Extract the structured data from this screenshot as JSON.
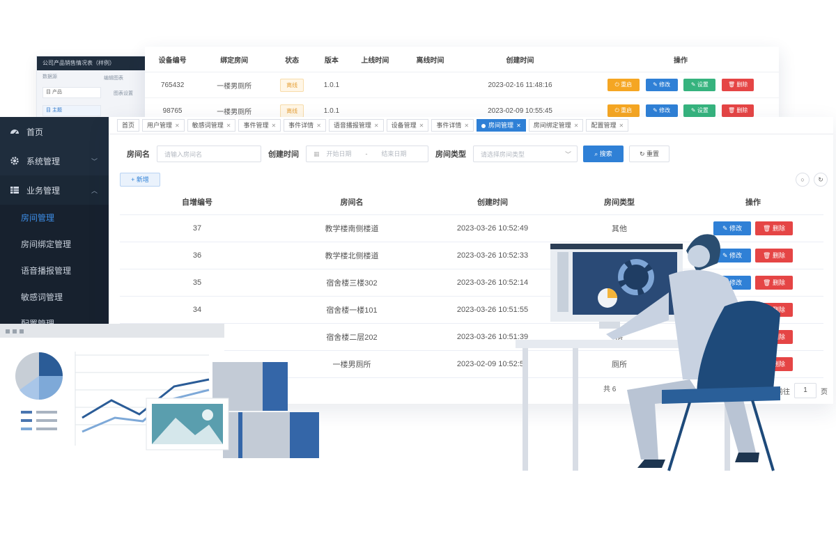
{
  "back_window": {
    "title": "公司产品销售情况表（样例）",
    "row1": "数据源",
    "col2": "编辑图表",
    "col3": "图表设置",
    "side1": "目 产品",
    "side2": "目 主题"
  },
  "device_table": {
    "headers": [
      "设备编号",
      "绑定房间",
      "状态",
      "版本",
      "上线时间",
      "离线时间",
      "创建时间",
      "操作"
    ],
    "rows": [
      {
        "id": "765432",
        "room": "一楼男厕所",
        "status": "离线",
        "version": "1.0.1",
        "online": "",
        "offline": "",
        "created": "2023-02-16 11:48:16"
      },
      {
        "id": "98765",
        "room": "一楼男厕所",
        "status": "离线",
        "version": "1.0.1",
        "online": "",
        "offline": "",
        "created": "2023-02-09 10:55:45"
      }
    ],
    "actions": {
      "restart": "重启",
      "edit": "修改",
      "settings": "设置",
      "delete": "删除"
    }
  },
  "sidebar": {
    "home": "首页",
    "system": "系统管理",
    "business": "业务管理",
    "subitems": [
      "房间管理",
      "房间绑定管理",
      "语音播报管理",
      "敏感词管理",
      "配置管理"
    ]
  },
  "tabs": [
    {
      "label": "首页",
      "closable": false,
      "active": false
    },
    {
      "label": "用户管理",
      "closable": true,
      "active": false
    },
    {
      "label": "敏感词管理",
      "closable": true,
      "active": false
    },
    {
      "label": "事件管理",
      "closable": true,
      "active": false
    },
    {
      "label": "事件详情",
      "closable": true,
      "active": false
    },
    {
      "label": "语音播报管理",
      "closable": true,
      "active": false
    },
    {
      "label": "设备管理",
      "closable": true,
      "active": false
    },
    {
      "label": "事件详情",
      "closable": true,
      "active": false
    },
    {
      "label": "房间管理",
      "closable": true,
      "active": true
    },
    {
      "label": "房间绑定管理",
      "closable": true,
      "active": false
    },
    {
      "label": "配置管理",
      "closable": true,
      "active": false
    }
  ],
  "filters": {
    "room_name_label": "房间名",
    "room_name_placeholder": "请输入房间名",
    "created_label": "创建时间",
    "start_placeholder": "开始日期",
    "date_sep": "-",
    "end_placeholder": "结束日期",
    "room_type_label": "房间类型",
    "room_type_placeholder": "请选择房间类型",
    "search": "搜索",
    "reset": "重置",
    "add": "新增"
  },
  "room_table": {
    "headers": [
      "自增编号",
      "房间名",
      "创建时间",
      "房间类型",
      "操作"
    ],
    "rows": [
      {
        "id": "37",
        "name": "教学楼南侧楼道",
        "created": "2023-03-26 10:52:49",
        "type": "其他"
      },
      {
        "id": "36",
        "name": "教学楼北侧楼道",
        "created": "2023-03-26 10:52:33",
        "type": ""
      },
      {
        "id": "35",
        "name": "宿舍楼三楼302",
        "created": "2023-03-26 10:52:14",
        "type": ""
      },
      {
        "id": "34",
        "name": "宿舍楼一楼101",
        "created": "2023-03-26 10:51:55",
        "type": ""
      },
      {
        "id": "",
        "name": "宿舍楼二层202",
        "created": "2023-03-26 10:51:39",
        "type": "房"
      },
      {
        "id": "",
        "name": "一楼男厕所",
        "created": "2023-02-09 10:52:52",
        "type": "厕所"
      }
    ],
    "edit": "修改",
    "delete": "删除"
  },
  "pager": {
    "total": "共 6",
    "goto": "前往",
    "page": "1",
    "unit": "页"
  },
  "colors": {
    "sidebar_bg": "#1f2d3d",
    "primary": "#2f80d6",
    "danger": "#e54545",
    "warning": "#f5a623",
    "success": "#36b37e"
  }
}
